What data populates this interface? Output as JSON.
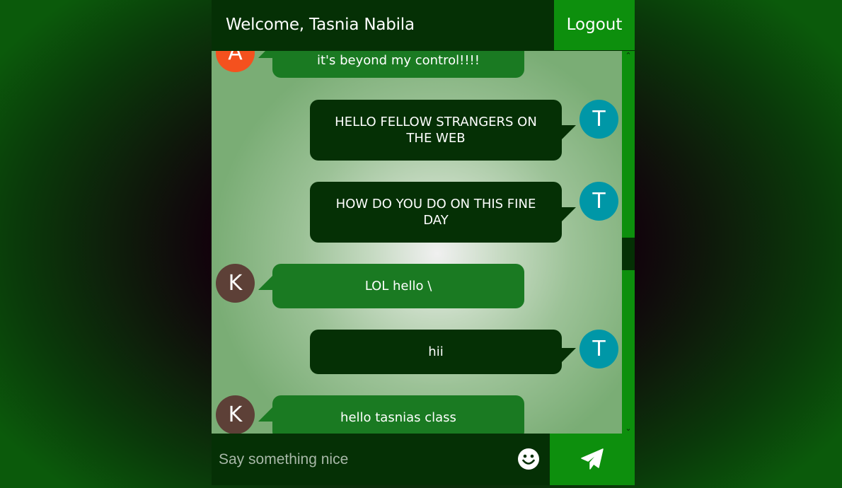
{
  "header": {
    "welcome": "Welcome, Tasnia Nabila",
    "logout_label": "Logout"
  },
  "messages": [
    {
      "side": "left",
      "avatar": "A",
      "avatar_color": "#f4511e",
      "text": "it's beyond my control!!!!"
    },
    {
      "side": "right",
      "avatar": "T",
      "avatar_color": "#0097a7",
      "text": "HELLO FELLOW STRANGERS ON THE WEB"
    },
    {
      "side": "right",
      "avatar": "T",
      "avatar_color": "#0097a7",
      "text": "HOW DO YOU DO ON THIS FINE DAY"
    },
    {
      "side": "left",
      "avatar": "K",
      "avatar_color": "#5d4037",
      "text": "LOL hello \\"
    },
    {
      "side": "right",
      "avatar": "T",
      "avatar_color": "#0097a7",
      "text": "hii"
    },
    {
      "side": "left",
      "avatar": "K",
      "avatar_color": "#5d4037",
      "text": "hello tasnias class"
    }
  ],
  "composer": {
    "placeholder": "Say something nice",
    "emoji_icon": "smiley-icon",
    "send_icon": "paper-plane-icon"
  },
  "colors": {
    "dark_green": "#053005",
    "accent_green": "#0d8f0d",
    "bubble_green": "#1a7a22"
  }
}
